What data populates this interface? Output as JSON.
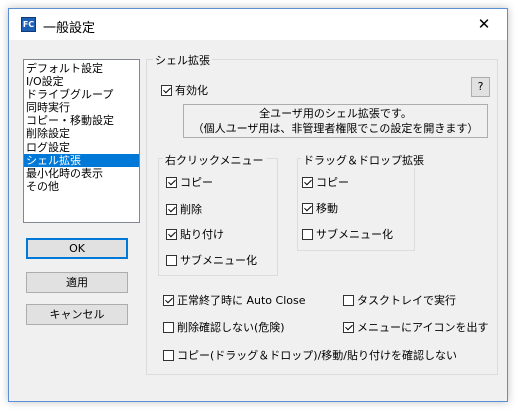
{
  "window": {
    "title": "一般設定",
    "app_icon_text": "FC",
    "close_glyph": "✕"
  },
  "sidebar": {
    "items": [
      {
        "label": "デフォルト設定",
        "selected": false
      },
      {
        "label": "I/O設定",
        "selected": false
      },
      {
        "label": "ドライブグループ",
        "selected": false
      },
      {
        "label": "同時実行",
        "selected": false
      },
      {
        "label": "コピー・移動設定",
        "selected": false
      },
      {
        "label": "削除設定",
        "selected": false
      },
      {
        "label": "ログ設定",
        "selected": false
      },
      {
        "label": "シェル拡張",
        "selected": true
      },
      {
        "label": "最小化時の表示",
        "selected": false
      },
      {
        "label": "その他",
        "selected": false
      }
    ]
  },
  "buttons": {
    "ok": "OK",
    "apply": "適用",
    "cancel": "キャンセル"
  },
  "shell": {
    "section_title": "シェル拡張",
    "enable_label": "有効化",
    "enable_checked": true,
    "help_label": "?",
    "info_line1": "全ユーザ用のシェル拡張です。",
    "info_line2": "（個人ユーザ用は、非管理者権限でこの設定を開きます）",
    "right_click": {
      "title": "右クリックメニュー",
      "copy": {
        "label": "コピー",
        "checked": true
      },
      "delete": {
        "label": "削除",
        "checked": true
      },
      "paste": {
        "label": "貼り付け",
        "checked": true
      },
      "submenu": {
        "label": "サブメニュー化",
        "checked": false
      }
    },
    "drag_drop": {
      "title": "ドラッグ＆ドロップ拡張",
      "copy": {
        "label": "コピー",
        "checked": true
      },
      "move": {
        "label": "移動",
        "checked": true
      },
      "submenu": {
        "label": "サブメニュー化",
        "checked": false
      }
    },
    "options": {
      "auto_close": {
        "label": "正常終了時に Auto Close",
        "checked": true
      },
      "tasktray": {
        "label": "タスクトレイで実行",
        "checked": false
      },
      "no_delete_confirm": {
        "label": "削除確認しない(危険)",
        "checked": false
      },
      "menu_icon": {
        "label": "メニューにアイコンを出す",
        "checked": true
      },
      "no_copy_confirm": {
        "label": "コピー(ドラッグ＆ドロップ)/移動/貼り付けを確認しない",
        "checked": false
      }
    }
  }
}
